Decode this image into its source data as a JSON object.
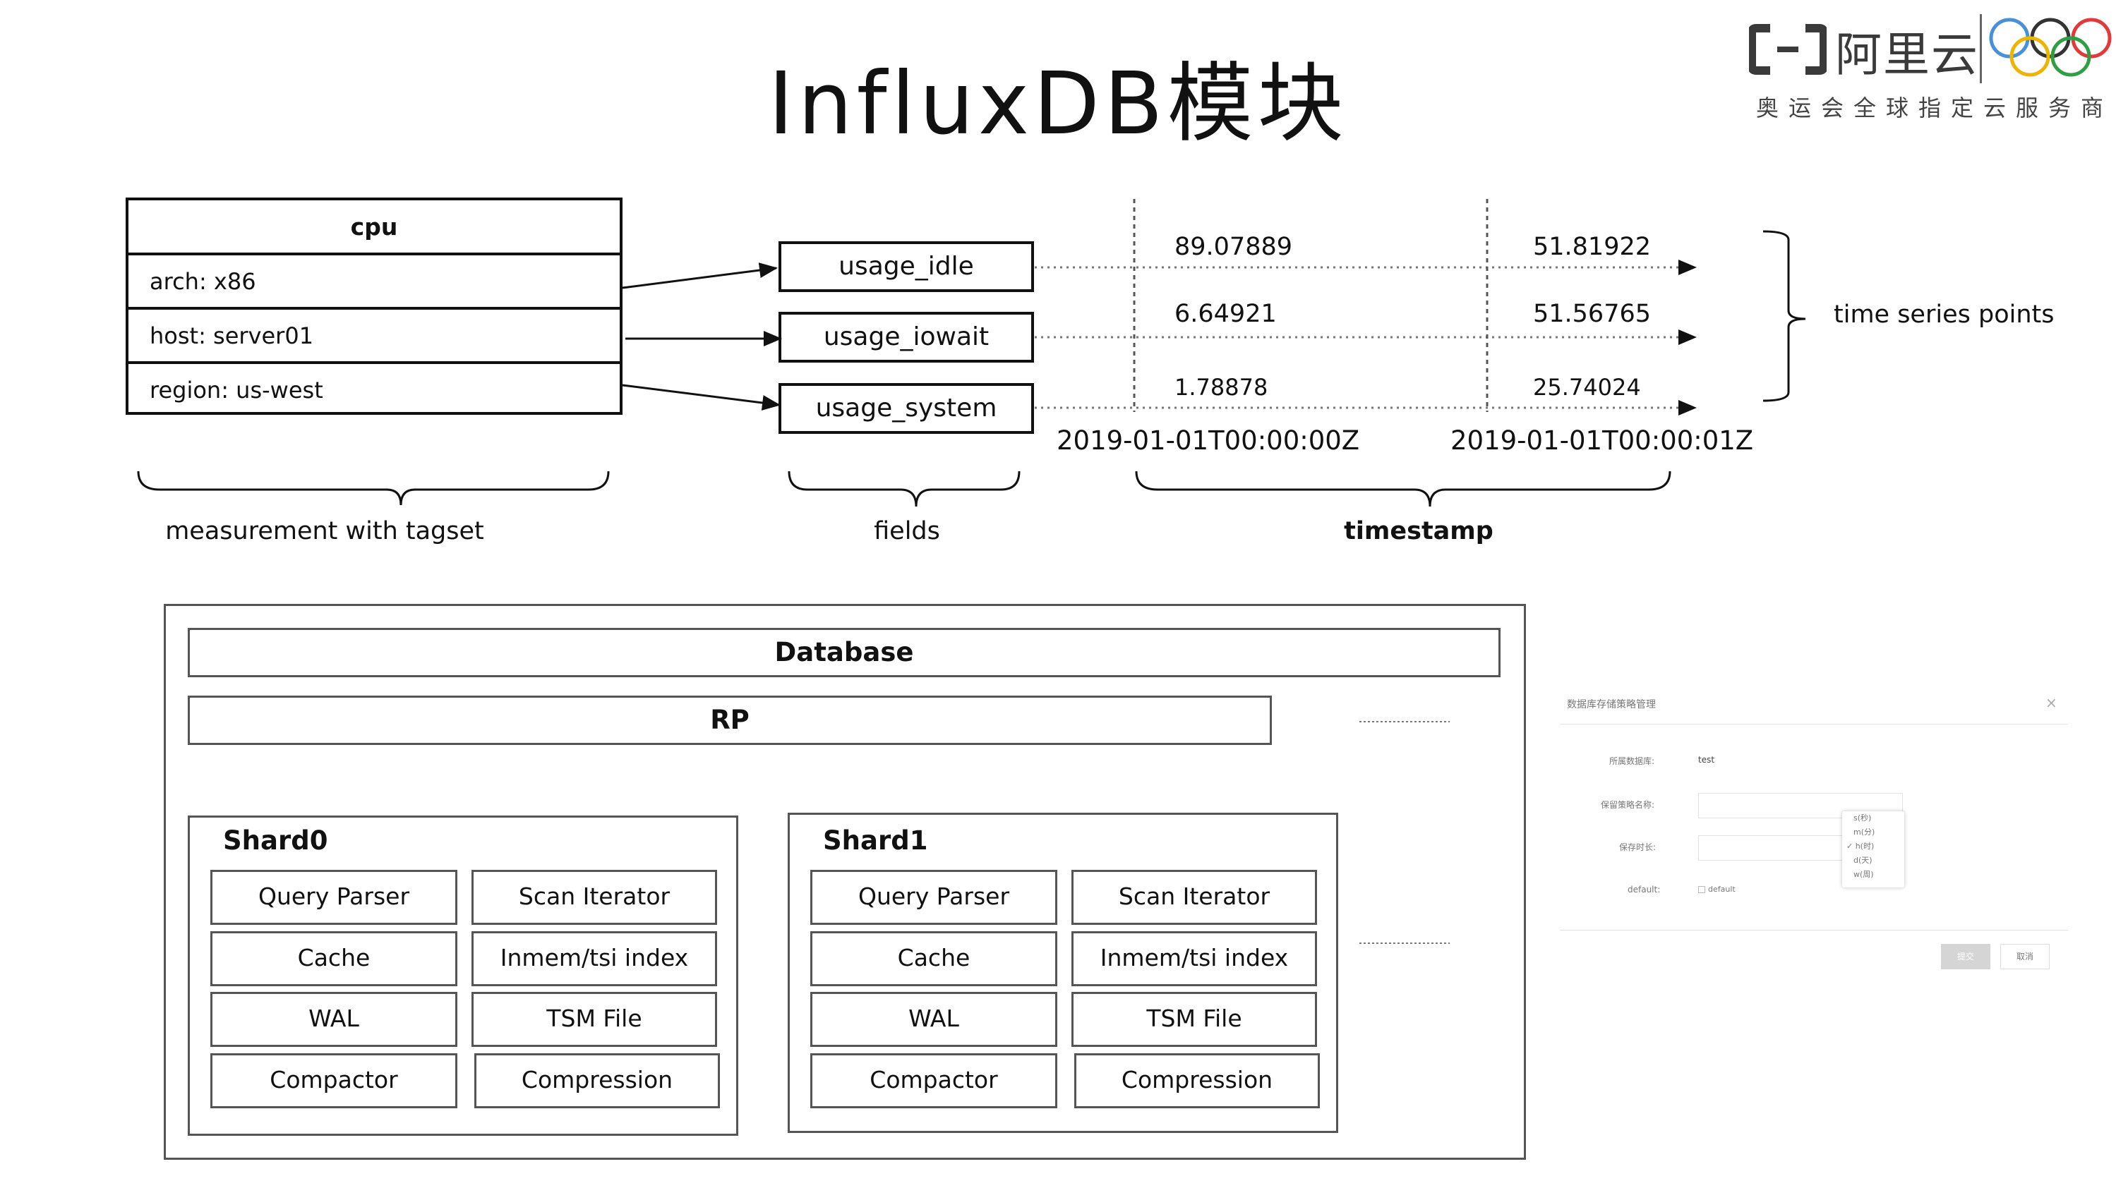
{
  "title": "InfluxDB模块",
  "logo": {
    "name": "阿里云",
    "subtitle": "奥运会全球指定云服务商"
  },
  "measurement": {
    "name": "cpu",
    "tags": [
      "arch:  x86",
      "host: server01",
      "region: us-west"
    ]
  },
  "fields": [
    "usage_idle",
    "usage_iowait",
    "usage_system"
  ],
  "points": [
    [
      "89.07889",
      "51.81922"
    ],
    [
      "6.64921",
      "51.56765"
    ],
    [
      "1.78878",
      "25.74024"
    ]
  ],
  "timestamps": [
    "2019-01-01T00:00:00Z",
    "2019-01-01T00:00:01Z"
  ],
  "labels": {
    "series": "time series points",
    "measurement": "measurement with tagset",
    "fields": "fields",
    "timestamp": "timestamp"
  },
  "storage": {
    "database": "Database",
    "rp": "RP",
    "shards": [
      {
        "name": "Shard0",
        "components": [
          "Query Parser",
          "Scan Iterator",
          "Cache",
          "Inmem/tsi index",
          "WAL",
          "TSM File",
          "Compactor",
          "Compression"
        ]
      },
      {
        "name": "Shard1",
        "components": [
          "Query Parser",
          "Scan Iterator",
          "Cache",
          "Inmem/tsi index",
          "WAL",
          "TSM File",
          "Compactor",
          "Compression"
        ]
      }
    ]
  },
  "dialog": {
    "title": "数据库存储策略管理",
    "close": "×",
    "db_label": "所属数据库:",
    "db_value": "test",
    "name_label": "保留策略名称:",
    "duration_label": "保存时长:",
    "default_label": "default:",
    "default_option": "default",
    "units": [
      "s(秒)",
      "m(分)",
      "✓ h(时)",
      "d(天)",
      "w(周)"
    ],
    "submit": "提交",
    "cancel": "取消"
  }
}
